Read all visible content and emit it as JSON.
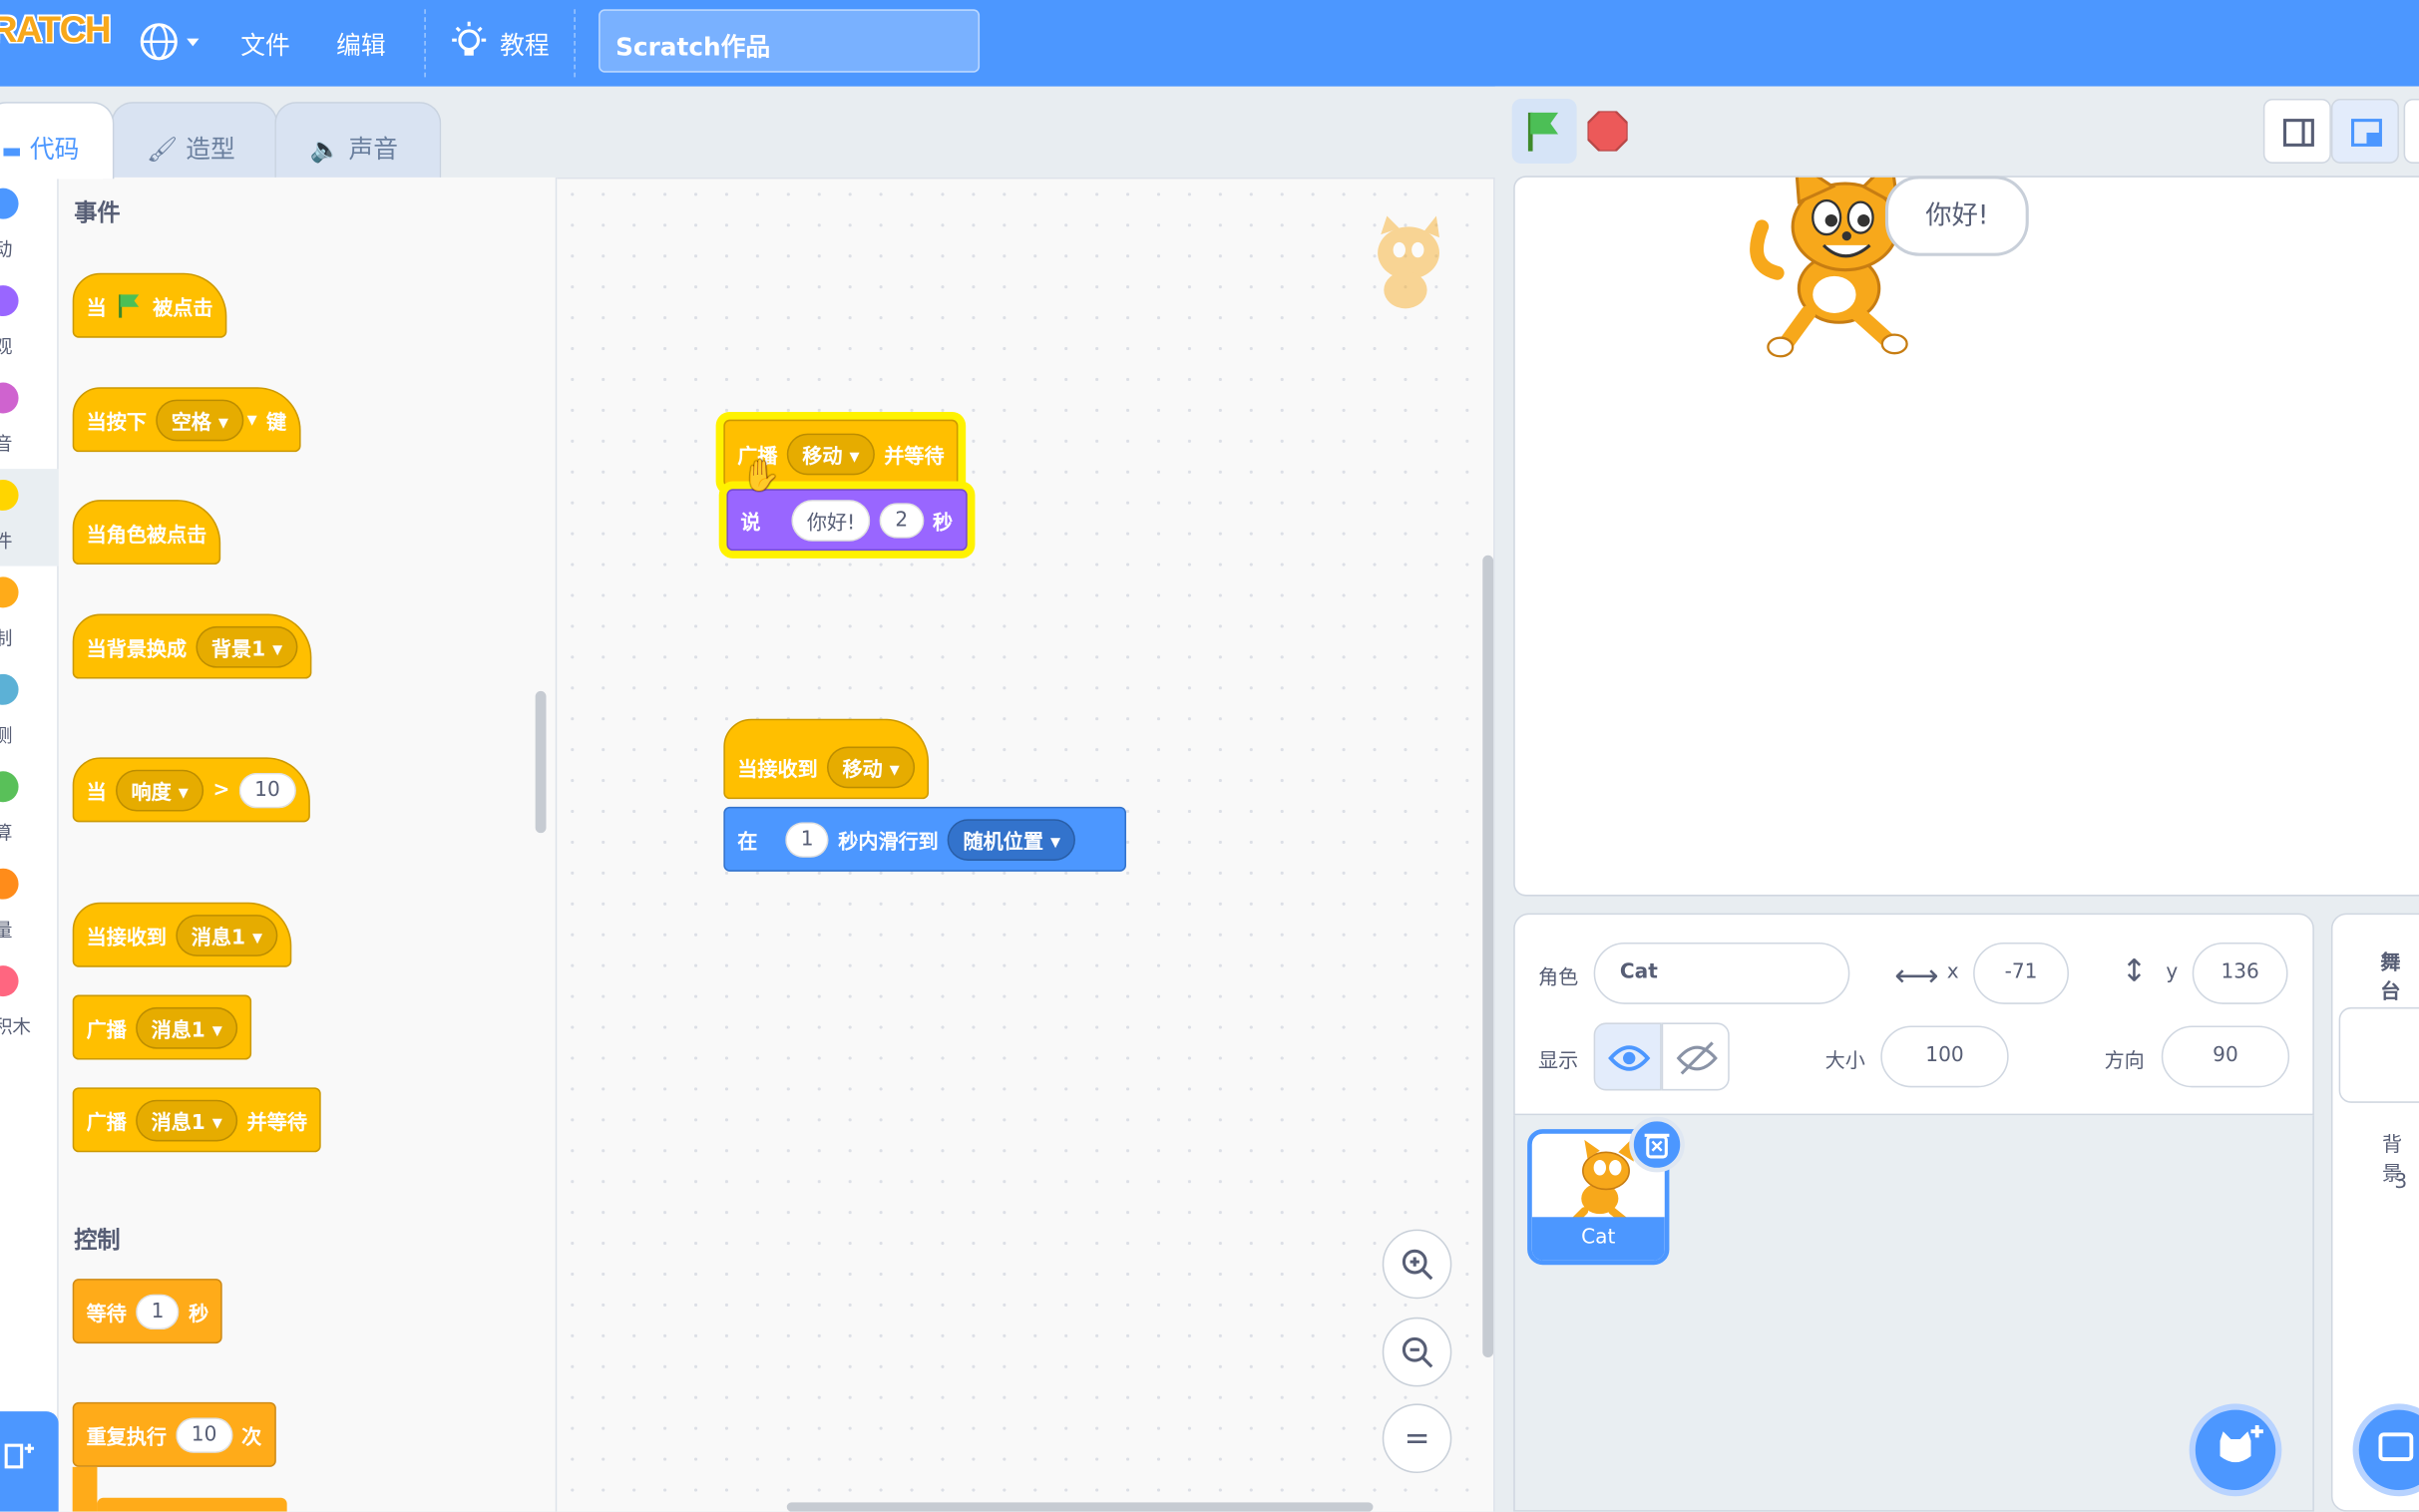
{
  "menu": {
    "logo": "RATCH",
    "file": "文件",
    "edit": "编辑",
    "tutorial": "教程",
    "project_title": "Scratch作品"
  },
  "tabs": {
    "code": "代码",
    "costumes": "造型",
    "sounds": "声音"
  },
  "categories": [
    "动",
    "观",
    "音",
    "件",
    "制",
    "测",
    "算",
    "量",
    "积木"
  ],
  "palette": {
    "events_title": "事件",
    "when_flag": {
      "pre": "当",
      "post": "被点击"
    },
    "when_key": {
      "pre": "当按下",
      "key": "空格",
      "post": "键"
    },
    "when_sprite_clicked": "当角色被点击",
    "when_backdrop": {
      "pre": "当背景换成",
      "value": "背景1"
    },
    "when_greater": {
      "pre": "当",
      "menu": "响度",
      "op": ">",
      "value": "10"
    },
    "when_receive": {
      "pre": "当接收到",
      "value": "消息1"
    },
    "broadcast": {
      "pre": "广播",
      "value": "消息1"
    },
    "broadcast_wait": {
      "pre": "广播",
      "value": "消息1",
      "post": "并等待"
    },
    "control_title": "控制",
    "wait": {
      "pre": "等待",
      "value": "1",
      "post": "秒"
    },
    "repeat": {
      "pre": "重复执行",
      "value": "10",
      "post": "次"
    }
  },
  "workspace": {
    "script1": {
      "broadcast_wait": {
        "pre": "广播",
        "value": "移动",
        "post": "并等待"
      },
      "say": {
        "pre": "说",
        "text": "你好!",
        "secs": "2",
        "post": "秒"
      }
    },
    "script2": {
      "hat": {
        "pre": "当接收到",
        "value": "移动"
      },
      "glide": {
        "pre": "在",
        "secs": "1",
        "mid": "秒内滑行到",
        "target": "随机位置"
      }
    },
    "zoom_reset": "="
  },
  "stage": {
    "bubble": "你好!"
  },
  "sprite_info": {
    "sprite_label": "角色",
    "name": "Cat",
    "x_label": "x",
    "x": "-71",
    "y_label": "y",
    "y": "136",
    "show_label": "显示",
    "size_label": "大小",
    "size": "100",
    "direction_label": "方向",
    "direction": "90"
  },
  "sprites": [
    {
      "name": "Cat"
    }
  ],
  "stage_panel": {
    "title": "舞台",
    "backdrops_label": "背景",
    "backdrops_count": "3"
  },
  "colors": {
    "menubar": "#4c97ff",
    "events": "#ffbf00",
    "looks": "#9966ff",
    "motion": "#4c97ff",
    "control": "#ffab19"
  }
}
